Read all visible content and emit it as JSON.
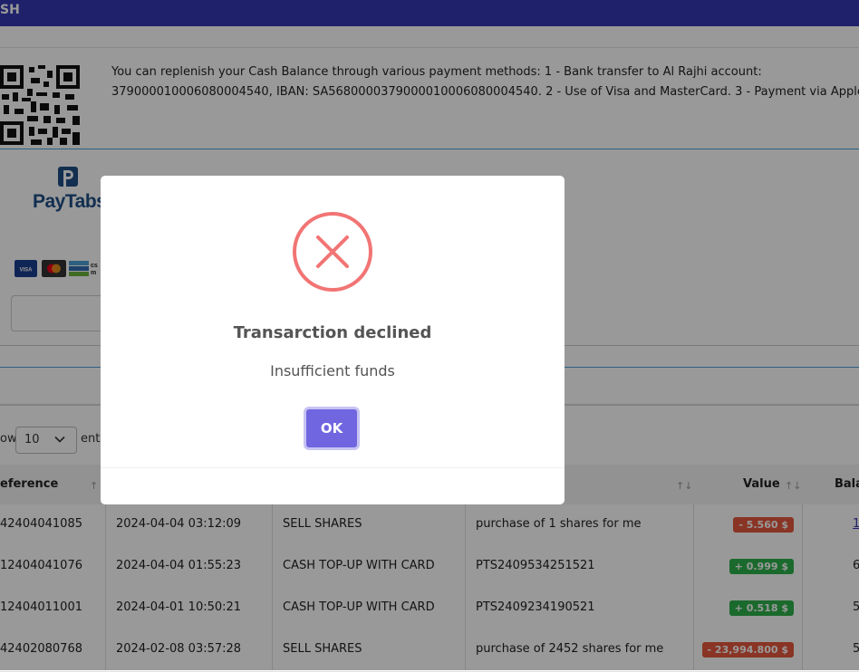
{
  "header": {
    "title": "SH"
  },
  "payment_info": {
    "line1": "You can replenish your Cash Balance through various payment methods: 1 - Bank transfer to Al Rajhi account:",
    "line2": "379000010006080004540, IBAN: SA5680000379000010006080004540. 2 - Use of Visa and MasterCard. 3 - Payment via AppleP"
  },
  "paytabs": {
    "brand": "PayTabs"
  },
  "table_controls": {
    "show_label": "ow",
    "page_size": "10",
    "entries_label": "entr"
  },
  "table": {
    "headers": {
      "reference": "eference",
      "value": "Value",
      "balance": "Bala"
    },
    "rows": [
      {
        "reference": "42404041085",
        "date": "2024-04-04 03:12:09",
        "type": "SELL SHARES",
        "description": "purchase of 1 shares for me",
        "value": "- 5.560 $",
        "sign": "neg",
        "balance": "1"
      },
      {
        "reference": "12404041076",
        "date": "2024-04-04 01:55:23",
        "type": "CASH TOP-UP WITH CARD",
        "description": "PTS2409534251521",
        "value": "+ 0.999 $",
        "sign": "pos",
        "balance": "6"
      },
      {
        "reference": "12404011001",
        "date": "2024-04-01 10:50:21",
        "type": "CASH TOP-UP WITH CARD",
        "description": "PTS2409234190521",
        "value": "+ 0.518 $",
        "sign": "pos",
        "balance": "5"
      },
      {
        "reference": "42402080768",
        "date": "2024-02-08 03:57:28",
        "type": "SELL SHARES",
        "description": "purchase of 2452 shares for me",
        "value": "- 23,994.800 $",
        "sign": "neg",
        "balance": "5"
      }
    ]
  },
  "dialog": {
    "icon": "error-x-icon",
    "title": "Transarction declined",
    "message": "Insufficient funds",
    "ok_label": "OK"
  },
  "colors": {
    "header": "#3437b2",
    "accent": "#7066e0",
    "error": "#f27474",
    "negative": "#e4573c",
    "positive": "#2eb14c"
  }
}
